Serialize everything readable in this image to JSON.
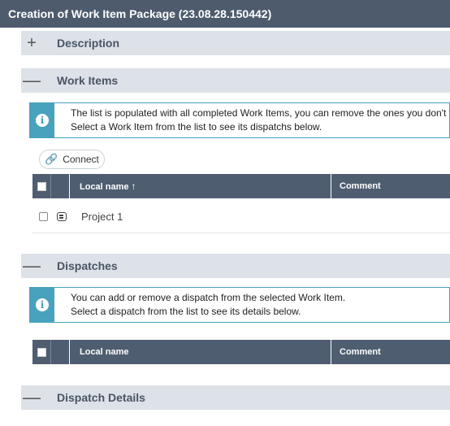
{
  "window": {
    "title": "Creation of Work Item Package (23.08.28.150442)"
  },
  "sections": {
    "description": {
      "label": "Description",
      "toggle": "+"
    },
    "work_items": {
      "label": "Work Items",
      "toggle": "—",
      "info_line1": "The list is populated with all completed Work Items, you can remove the ones you don't want",
      "info_line2": "Select a Work Item from the list to see its dispatchs below.",
      "connect_label": "Connect",
      "columns": {
        "local_name": "Local name",
        "comment": "Comment"
      },
      "sort_indicator": "↑",
      "rows": [
        {
          "local_name": "Project 1",
          "comment": ""
        }
      ]
    },
    "dispatches": {
      "label": "Dispatches",
      "toggle": "—",
      "info_line1": "You can add or remove a dispatch from the selected Work Item.",
      "info_line2": "Select a dispatch from the list to see its details below.",
      "columns": {
        "local_name": "Local name",
        "comment": "Comment"
      }
    },
    "dispatch_details": {
      "label": "Dispatch Details",
      "toggle": "—"
    }
  },
  "icons": {
    "info": "info-icon",
    "connect": "link-icon",
    "row": "work-item-icon"
  },
  "colors": {
    "title_bar": "#4d5b6d",
    "section_header": "#dde1e8",
    "grid_header": "#4f5d70",
    "info_accent": "#49a2bd"
  }
}
